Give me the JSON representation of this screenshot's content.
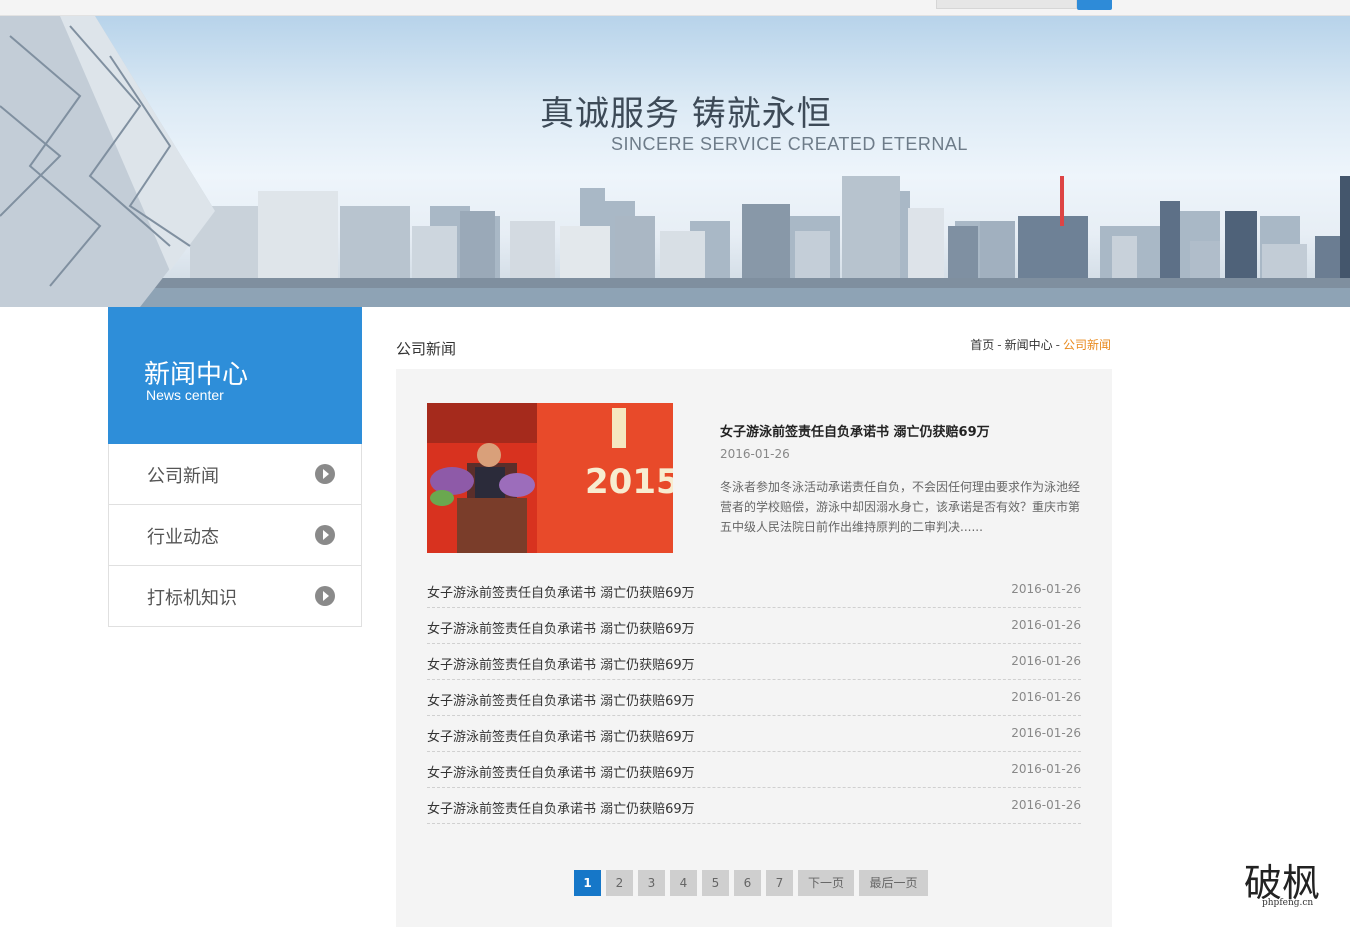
{
  "banner": {
    "title": "真诚服务 铸就永恒",
    "subtitle": "SINCERE SERVICE  CREATED ETERNAL"
  },
  "sidebar": {
    "title": "新闻中心",
    "subtitle": "News center",
    "items": [
      {
        "label": "公司新闻"
      },
      {
        "label": "行业动态"
      },
      {
        "label": "打标机知识"
      }
    ]
  },
  "main": {
    "title": "公司新闻",
    "breadcrumb": {
      "home": "首页",
      "separator": "-",
      "section": "新闻中心",
      "current": "公司新闻"
    }
  },
  "featured": {
    "title": "女子游泳前签责任自负承诺书 溺亡仍获赔69万",
    "date": "2016-01-26",
    "summary": "冬泳者参加冬泳活动承诺责任自负，不会因任何理由要求作为泳池经营者的学校赔偿，游泳中却因溺水身亡，该承诺是否有效？重庆市第五中级人民法院日前作出维持原判的二审判决......",
    "image_text": "2015"
  },
  "news": [
    {
      "title": "女子游泳前签责任自负承诺书 溺亡仍获赔69万",
      "date": "2016-01-26"
    },
    {
      "title": "女子游泳前签责任自负承诺书 溺亡仍获赔69万",
      "date": "2016-01-26"
    },
    {
      "title": "女子游泳前签责任自负承诺书 溺亡仍获赔69万",
      "date": "2016-01-26"
    },
    {
      "title": "女子游泳前签责任自负承诺书 溺亡仍获赔69万",
      "date": "2016-01-26"
    },
    {
      "title": "女子游泳前签责任自负承诺书 溺亡仍获赔69万",
      "date": "2016-01-26"
    },
    {
      "title": "女子游泳前签责任自负承诺书 溺亡仍获赔69万",
      "date": "2016-01-26"
    },
    {
      "title": "女子游泳前签责任自负承诺书 溺亡仍获赔69万",
      "date": "2016-01-26"
    }
  ],
  "pagination": {
    "pages": [
      "1",
      "2",
      "3",
      "4",
      "5",
      "6",
      "7"
    ],
    "current": "1",
    "next": "下一页",
    "last": "最后一页"
  },
  "watermark": {
    "logo_text": "破枫",
    "domain": "phpfeng.cn"
  },
  "colors": {
    "accent": "#2e8ed9",
    "breadcrumb_active": "#e98a1e",
    "pager_current": "#1677c8"
  }
}
